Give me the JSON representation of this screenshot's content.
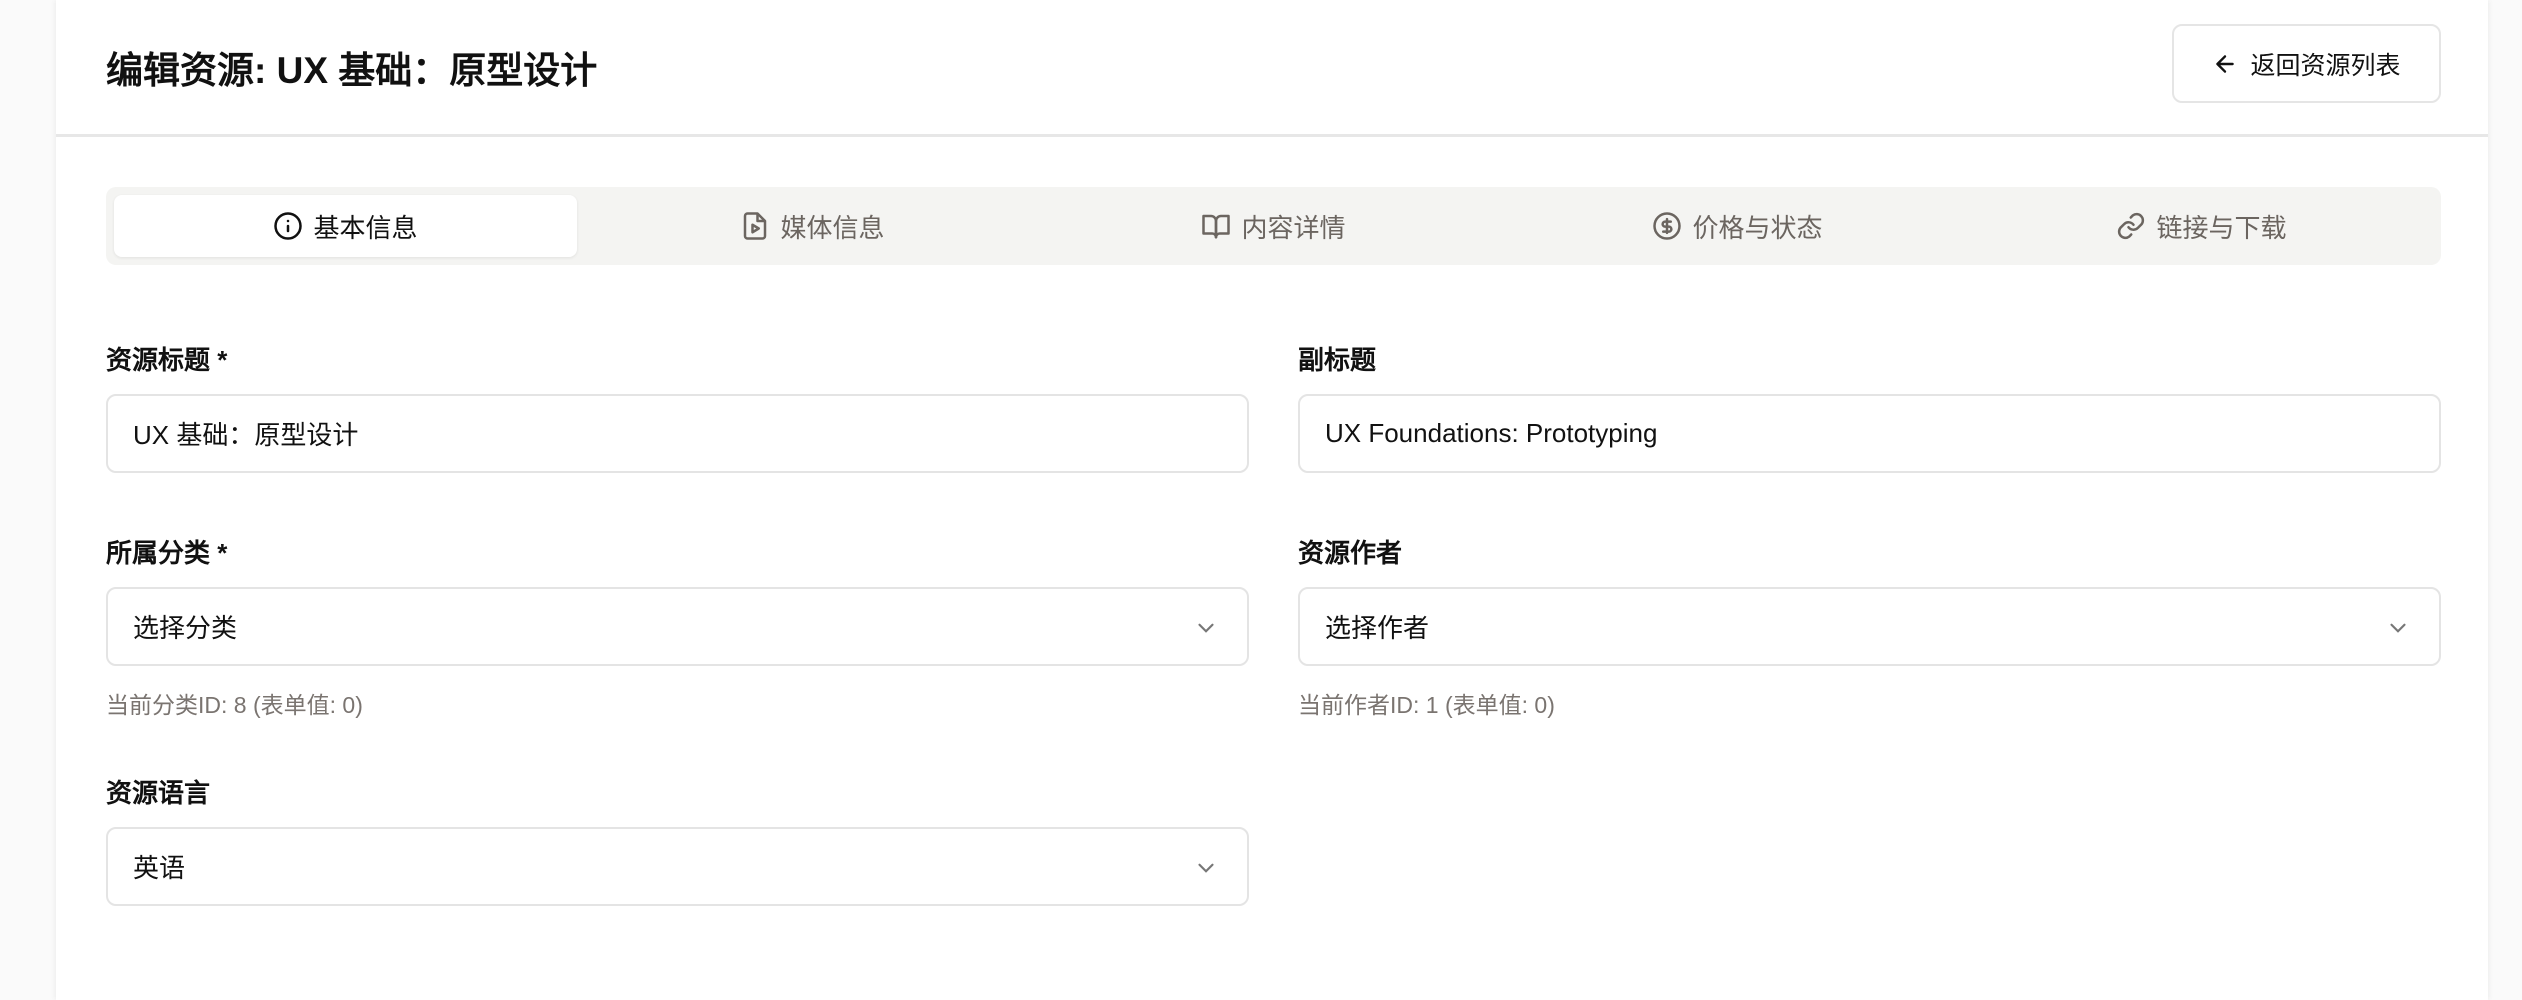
{
  "header": {
    "title": "编辑资源: UX 基础：原型设计",
    "back_label": "返回资源列表"
  },
  "tabs": [
    {
      "label": "基本信息",
      "icon": "info-icon",
      "active": true
    },
    {
      "label": "媒体信息",
      "icon": "file-play-icon"
    },
    {
      "label": "内容详情",
      "icon": "book-open-icon"
    },
    {
      "label": "价格与状态",
      "icon": "dollar-circle-icon"
    },
    {
      "label": "链接与下载",
      "icon": "link-icon"
    }
  ],
  "form": {
    "title": {
      "label": "资源标题 *",
      "value": "UX 基础：原型设计"
    },
    "subtitle": {
      "label": "副标题",
      "value": "UX Foundations: Prototyping"
    },
    "category": {
      "label": "所属分类 *",
      "value": "选择分类",
      "hint": "当前分类ID: 8 (表单值: 0)"
    },
    "author": {
      "label": "资源作者",
      "value": "选择作者",
      "hint": "当前作者ID: 1 (表单值: 0)"
    },
    "language": {
      "label": "资源语言",
      "value": "英语"
    }
  }
}
